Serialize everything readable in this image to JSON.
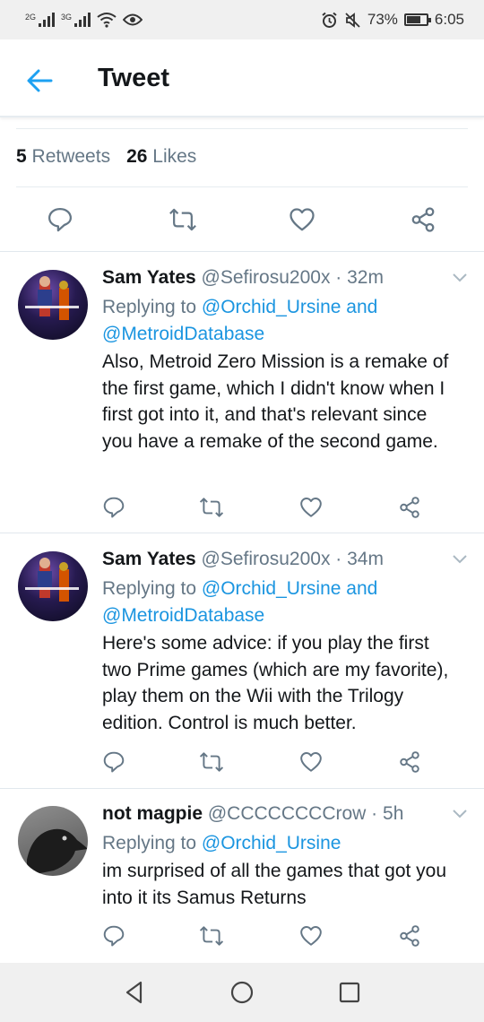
{
  "status_bar": {
    "sim1": "2G",
    "sim2": "3G",
    "battery_percent": "73%",
    "battery_level": 0.73,
    "time": "6:05"
  },
  "header": {
    "title": "Tweet"
  },
  "stats": {
    "retweets_count": "5",
    "retweets_label": "Retweets",
    "likes_count": "26",
    "likes_label": "Likes"
  },
  "replies": [
    {
      "name": "Sam Yates",
      "handle": "@Sefirosu200x",
      "time": "32m",
      "replying_prefix": "Replying to",
      "replying_to": "@Orchid_Ursine and @MetroidDatabase",
      "text": "Also, Metroid Zero Mission is a remake of the first game, which I didn't know when I first got into it, and that's relevant since you have a remake of the second game."
    },
    {
      "name": "Sam Yates",
      "handle": "@Sefirosu200x",
      "time": "34m",
      "replying_prefix": "Replying to",
      "replying_to": "@Orchid_Ursine and @MetroidDatabase",
      "text": "Here's some advice: if you play the first two Prime games (which are my favorite), play them on the Wii with the Trilogy edition. Control is much better."
    },
    {
      "name": "not magpie",
      "handle": "@CCCCCCCCrow",
      "time": "5h",
      "replying_prefix": "Replying to",
      "replying_to": "@Orchid_Ursine",
      "text": "im surprised of all the games that got you into it its Samus Returns"
    }
  ],
  "icons": {
    "back": "arrow-left-icon",
    "reply": "reply-icon",
    "retweet": "retweet-icon",
    "like": "heart-icon",
    "share": "share-icon",
    "more": "chevron-down-icon",
    "nav_back": "triangle-back-icon",
    "nav_home": "circle-home-icon",
    "nav_recents": "square-recents-icon"
  },
  "colors": {
    "accent": "#1da1f2",
    "text": "#14171a",
    "secondary": "#657786",
    "link": "#1b95e0"
  }
}
